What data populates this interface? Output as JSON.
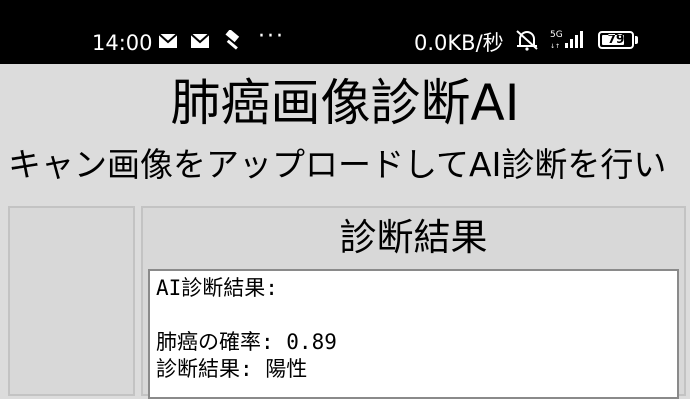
{
  "status_bar": {
    "time": "14:00",
    "icons": [
      "mail-icon",
      "mail-icon",
      "hammer-icon"
    ],
    "more": "···",
    "net_speed": "0.0KB/秒",
    "right_icons": [
      "alarm-off-icon",
      "signal-5g-icon"
    ],
    "battery": "79",
    "battery_level": 79
  },
  "app": {
    "title": "肺癌画像診断AI",
    "subtitle": "キャン画像をアップロードしてAI診断を行い"
  },
  "result": {
    "heading": "診断結果",
    "text": "AI診断結果:\n\n肺癌の確率: 0.89\n診断結果: 陽性"
  }
}
